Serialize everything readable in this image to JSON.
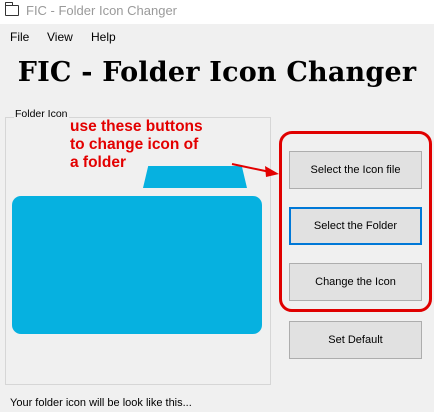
{
  "window": {
    "title": "FIC - Folder Icon Changer",
    "icon": "folder-outline-icon"
  },
  "menu": {
    "items": [
      "File",
      "View",
      "Help"
    ]
  },
  "headline": "FIC - Folder Icon Changer",
  "preview": {
    "group_label": "Folder Icon",
    "folder_color": "#06b1e0",
    "folder_icon": "folder-icon"
  },
  "annotation": {
    "lines": [
      "use these buttons",
      "to change icon of",
      "a folder"
    ],
    "color": "#e30000"
  },
  "buttons": {
    "select_icon_file": "Select the Icon file",
    "select_folder": "Select the Folder",
    "change_icon": "Change the Icon",
    "set_default": "Set Default"
  },
  "status": "Your folder icon will be look like this..."
}
